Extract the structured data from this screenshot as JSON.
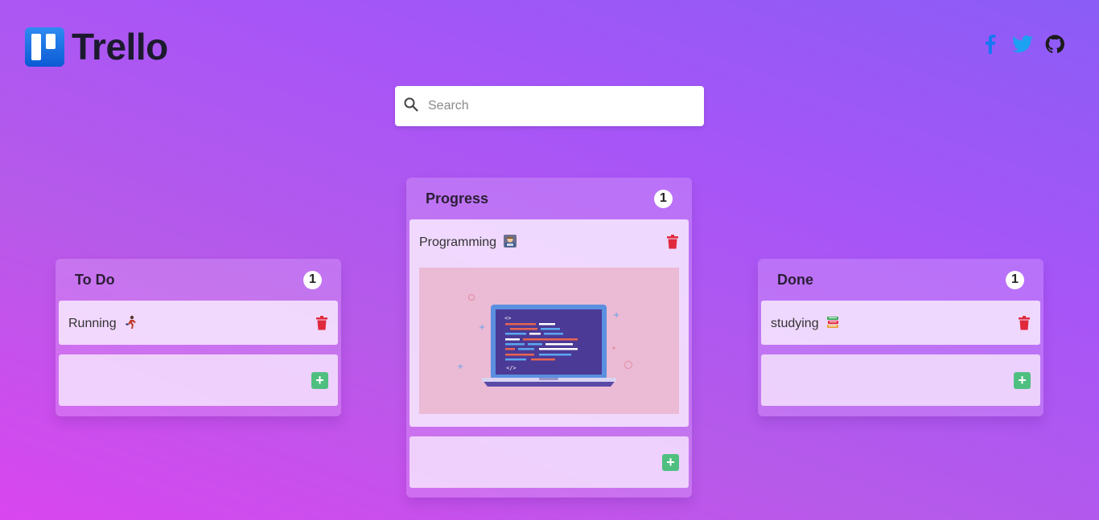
{
  "app": {
    "title": "Trello"
  },
  "search": {
    "placeholder": "Search",
    "value": ""
  },
  "social": {
    "icons": [
      "facebook-icon",
      "twitter-icon",
      "github-icon"
    ]
  },
  "colors": {
    "brand": "#0b5ad4",
    "delete": "#e0293d",
    "add": "#4fbf80",
    "facebook": "#1877f2",
    "twitter": "#1da1f2"
  },
  "columns": [
    {
      "title": "To Do",
      "count": "1",
      "cards": [
        {
          "text": "Running",
          "emoji": "runner"
        }
      ]
    },
    {
      "title": "Progress",
      "count": "1",
      "cards": [
        {
          "text": "Programming",
          "emoji": "technologist",
          "image": "laptop-code-illustration"
        }
      ]
    },
    {
      "title": "Done",
      "count": "1",
      "cards": [
        {
          "text": "studying",
          "emoji": "books"
        }
      ]
    }
  ]
}
